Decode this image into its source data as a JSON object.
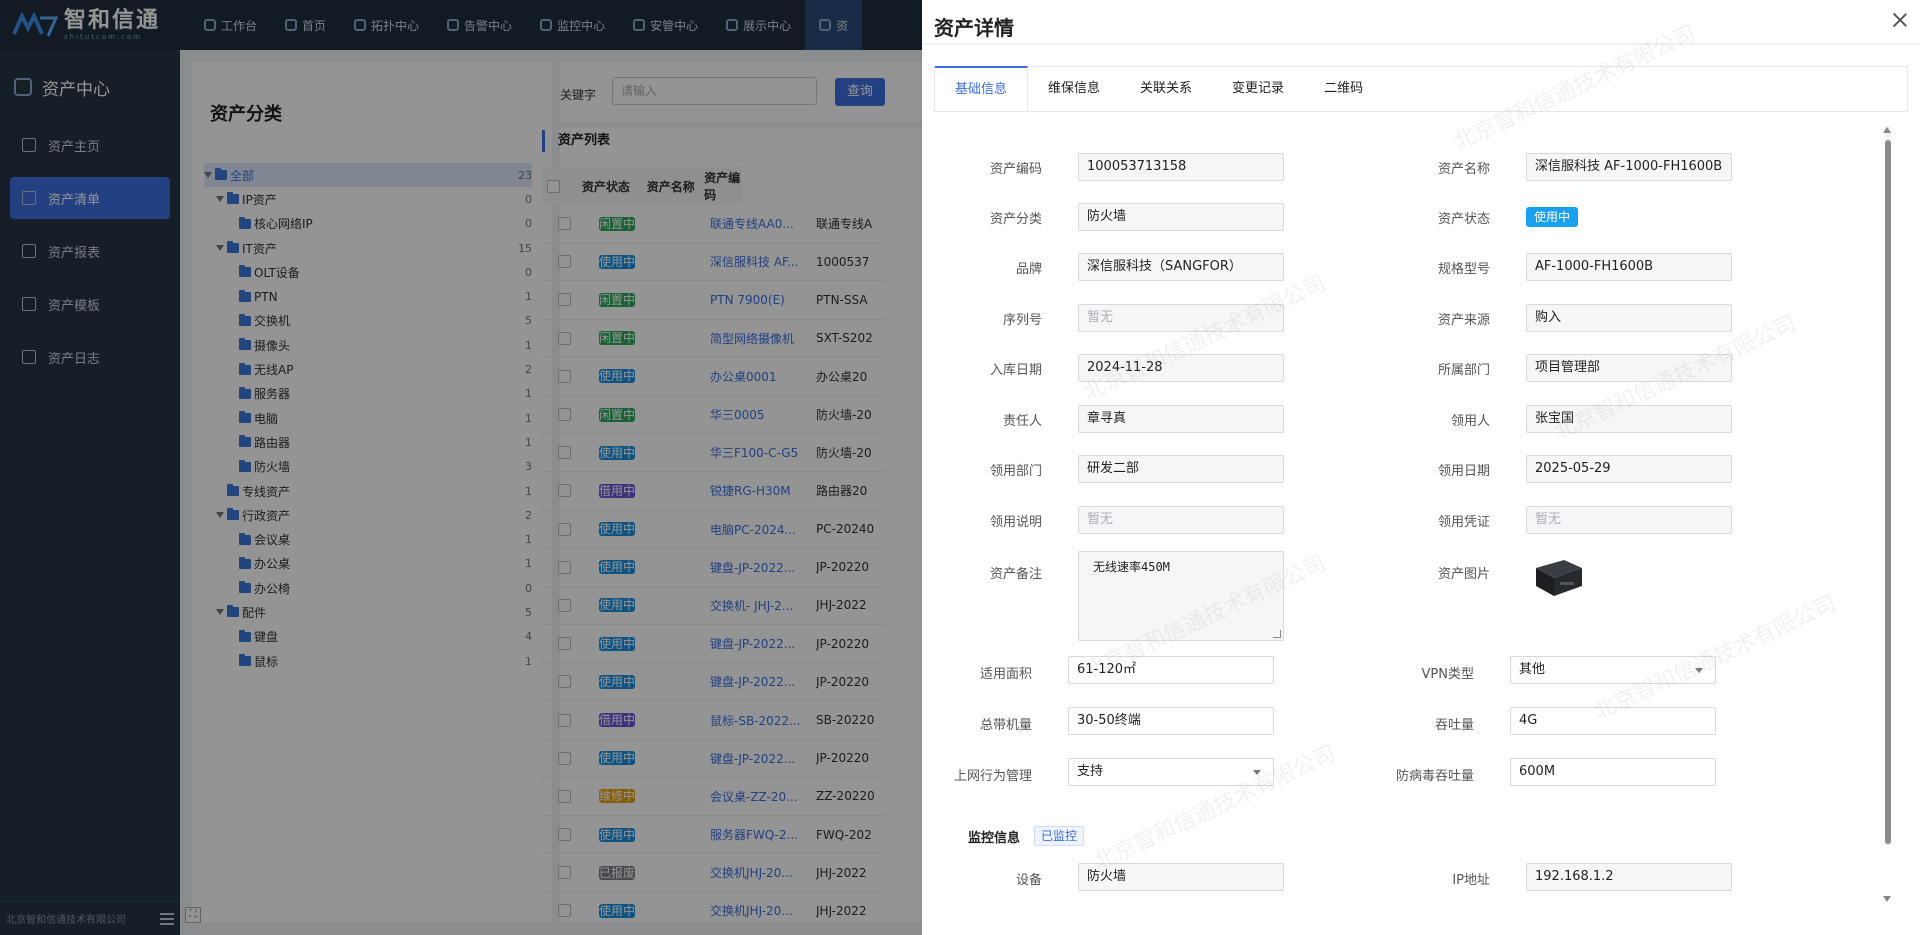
{
  "topbar": {
    "logo_name": "智和信通",
    "logo_sub": "zhitutcom.com",
    "nav": [
      {
        "label": "工作台",
        "icon": "home-icon"
      },
      {
        "label": "首页",
        "icon": "home-icon"
      },
      {
        "label": "拓扑中心",
        "icon": "topology-icon"
      },
      {
        "label": "告警中心",
        "icon": "alarm-icon"
      },
      {
        "label": "监控中心",
        "icon": "monitor-icon"
      },
      {
        "label": "安管中心",
        "icon": "shield-icon"
      },
      {
        "label": "展示中心",
        "icon": "display-icon"
      },
      {
        "label": "资",
        "icon": "asset-icon"
      }
    ]
  },
  "sidebar": {
    "title": "资产中心",
    "items": [
      {
        "label": "资产主页",
        "icon": "home-icon"
      },
      {
        "label": "资产清单",
        "icon": "list-icon"
      },
      {
        "label": "资产报表",
        "icon": "chart-icon"
      },
      {
        "label": "资产模板",
        "icon": "template-icon"
      },
      {
        "label": "资产日志",
        "icon": "log-icon"
      }
    ],
    "footer": "北京智和信通技术有限公司"
  },
  "tree": {
    "title": "资产分类",
    "nodes": [
      {
        "label": "全部",
        "count": "23",
        "level": 0,
        "arrow": true,
        "selected": true
      },
      {
        "label": "IP资产",
        "count": "0",
        "level": 1,
        "arrow": true
      },
      {
        "label": "核心网络IP",
        "count": "0",
        "level": 2,
        "arrow": false
      },
      {
        "label": "IT资产",
        "count": "15",
        "level": 1,
        "arrow": true
      },
      {
        "label": "OLT设备",
        "count": "0",
        "level": 2,
        "arrow": false
      },
      {
        "label": "PTN",
        "count": "1",
        "level": 2,
        "arrow": false
      },
      {
        "label": "交换机",
        "count": "5",
        "level": 2,
        "arrow": false
      },
      {
        "label": "摄像头",
        "count": "1",
        "level": 2,
        "arrow": false
      },
      {
        "label": "无线AP",
        "count": "2",
        "level": 2,
        "arrow": false
      },
      {
        "label": "服务器",
        "count": "1",
        "level": 2,
        "arrow": false
      },
      {
        "label": "电脑",
        "count": "1",
        "level": 2,
        "arrow": false
      },
      {
        "label": "路由器",
        "count": "1",
        "level": 2,
        "arrow": false
      },
      {
        "label": "防火墙",
        "count": "3",
        "level": 2,
        "arrow": false
      },
      {
        "label": "专线资产",
        "count": "1",
        "level": 1,
        "arrow": false
      },
      {
        "label": "行政资产",
        "count": "2",
        "level": 1,
        "arrow": true
      },
      {
        "label": "会议桌",
        "count": "1",
        "level": 2,
        "arrow": false
      },
      {
        "label": "办公桌",
        "count": "1",
        "level": 2,
        "arrow": false
      },
      {
        "label": "办公椅",
        "count": "0",
        "level": 2,
        "arrow": false
      },
      {
        "label": "配件",
        "count": "5",
        "level": 1,
        "arrow": true
      },
      {
        "label": "键盘",
        "count": "4",
        "level": 2,
        "arrow": false
      },
      {
        "label": "鼠标",
        "count": "1",
        "level": 2,
        "arrow": false
      }
    ]
  },
  "search": {
    "label": "关键字",
    "placeholder": "请输入",
    "button": "查询"
  },
  "list": {
    "title": "资产列表",
    "columns": [
      "资产状态",
      "资产名称",
      "资产编码"
    ],
    "rows": [
      {
        "status": "闲置中",
        "color": "#2eaa5c",
        "name": "联通专线AA0...",
        "code": "联通专线A"
      },
      {
        "status": "使用中",
        "color": "#1a8fe0",
        "name": "深信服科技 AF...",
        "code": "1000537"
      },
      {
        "status": "闲置中",
        "color": "#2eaa5c",
        "name": "PTN 7900(E)",
        "code": "PTN-SSA"
      },
      {
        "status": "闲置中",
        "color": "#2eaa5c",
        "name": "简型网络摄像机",
        "code": "SXT-S202"
      },
      {
        "status": "使用中",
        "color": "#1a8fe0",
        "name": "办公桌0001",
        "code": "办公桌20"
      },
      {
        "status": "闲置中",
        "color": "#2eaa5c",
        "name": "华三0005",
        "code": "防火墙-20"
      },
      {
        "status": "使用中",
        "color": "#1a8fe0",
        "name": "华三F100-C-G5",
        "code": "防火墙-20"
      },
      {
        "status": "借用中",
        "color": "#6c55d6",
        "name": "锐捷RG-H30M",
        "code": "路由器20"
      },
      {
        "status": "使用中",
        "color": "#1a8fe0",
        "name": "电脑PC-2024...",
        "code": "PC-20240"
      },
      {
        "status": "使用中",
        "color": "#1a8fe0",
        "name": "键盘-JP-2022...",
        "code": "JP-20220"
      },
      {
        "status": "使用中",
        "color": "#1a8fe0",
        "name": "交换机- JHJ-2...",
        "code": "JHJ-2022"
      },
      {
        "status": "使用中",
        "color": "#1a8fe0",
        "name": "键盘-JP-2022...",
        "code": "JP-20220"
      },
      {
        "status": "使用中",
        "color": "#1a8fe0",
        "name": "键盘-JP-2022...",
        "code": "JP-20220"
      },
      {
        "status": "借用中",
        "color": "#6c55d6",
        "name": "鼠标-SB-2022...",
        "code": "SB-20220"
      },
      {
        "status": "使用中",
        "color": "#1a8fe0",
        "name": "键盘-JP-2022...",
        "code": "JP-20220"
      },
      {
        "status": "维修中",
        "color": "#e6a317",
        "name": "会议桌-ZZ-20...",
        "code": "ZZ-20220"
      },
      {
        "status": "使用中",
        "color": "#1a8fe0",
        "name": "服务器FWQ-2...",
        "code": "FWQ-202"
      },
      {
        "status": "已报废",
        "color": "#7a7f87",
        "name": "交换机JHJ-20...",
        "code": "JHJ-2022"
      },
      {
        "status": "使用中",
        "color": "#1a8fe0",
        "name": "交换机JHJ-20...",
        "code": "JHJ-2022"
      }
    ]
  },
  "drawer": {
    "title": "资产详情",
    "tabs": [
      "基础信息",
      "维保信息",
      "关联关系",
      "变更记录",
      "二维码"
    ],
    "fields": {
      "asset_code": {
        "label": "资产编码",
        "value": "100053713158"
      },
      "asset_name": {
        "label": "资产名称",
        "value": "深信服科技 AF-1000-FH1600B"
      },
      "category": {
        "label": "资产分类",
        "value": "防火墙"
      },
      "status": {
        "label": "资产状态",
        "value": "使用中"
      },
      "brand": {
        "label": "品牌",
        "value": "深信服科技（SANGFOR）"
      },
      "model": {
        "label": "规格型号",
        "value": "AF-1000-FH1600B"
      },
      "serial": {
        "label": "序列号",
        "value": "暂无"
      },
      "source": {
        "label": "资产来源",
        "value": "购入"
      },
      "in_date": {
        "label": "入库日期",
        "value": "2024-11-28"
      },
      "department": {
        "label": "所属部门",
        "value": "项目管理部"
      },
      "owner": {
        "label": "责任人",
        "value": "章寻真"
      },
      "receiver": {
        "label": "领用人",
        "value": "张宝国"
      },
      "receive_dept": {
        "label": "领用部门",
        "value": "研发二部"
      },
      "receive_date": {
        "label": "领用日期",
        "value": "2025-05-29"
      },
      "receive_note": {
        "label": "领用说明",
        "value": "暂无"
      },
      "receive_proof": {
        "label": "领用凭证",
        "value": "暂无"
      },
      "remark": {
        "label": "资产备注",
        "value": "无线速率450M"
      },
      "image": {
        "label": "资产图片"
      },
      "area": {
        "label": "适用面积",
        "value": "61-120㎡"
      },
      "vpn": {
        "label": "VPN类型",
        "value": "其他"
      },
      "capacity": {
        "label": "总带机量",
        "value": "30-50终端"
      },
      "throughput": {
        "label": "吞吐量",
        "value": "4G"
      },
      "behavior": {
        "label": "上网行为管理",
        "value": "支持"
      },
      "av_throughput": {
        "label": "防病毒吞吐量",
        "value": "600M"
      }
    },
    "monitor": {
      "title": "监控信息",
      "tag": "已监控",
      "device_label": "设备",
      "device_value": "防火墙",
      "ip_label": "IP地址",
      "ip_value": "192.168.1.2"
    }
  },
  "watermark": "北京智和信通技术有限公司"
}
